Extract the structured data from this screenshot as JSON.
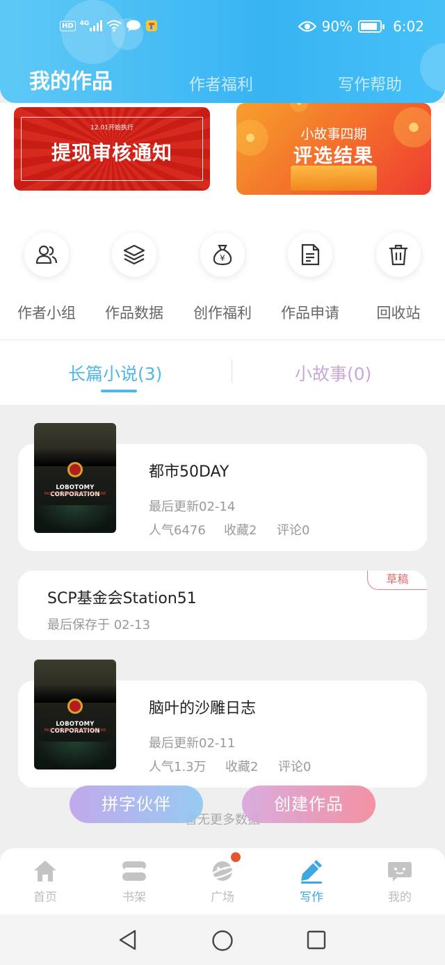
{
  "status_bar": {
    "hd": "HD",
    "network": "4G",
    "battery": "90%",
    "battery_level": 0.9,
    "time": "6:02"
  },
  "top_tabs": [
    {
      "label": "我的作品",
      "active": true
    },
    {
      "label": "作者福利",
      "active": false
    },
    {
      "label": "写作帮助",
      "active": false
    }
  ],
  "banners": {
    "left": {
      "small": "12.01开始执行",
      "big": "提现审核通知"
    },
    "right": {
      "line1": "小故事四期",
      "line2": "评选结果"
    }
  },
  "quick_actions": [
    {
      "label": "作者小组",
      "icon": "users-icon"
    },
    {
      "label": "作品数据",
      "icon": "layers-icon"
    },
    {
      "label": "创作福利",
      "icon": "money-bag-icon"
    },
    {
      "label": "作品申请",
      "icon": "document-icon"
    },
    {
      "label": "回收站",
      "icon": "trash-icon"
    }
  ],
  "segments": {
    "novel": "长篇小说(3)",
    "story": "小故事(0)"
  },
  "works": [
    {
      "title": "都市50DAY",
      "updated": "最后更新02-14",
      "popularity": "人气6476",
      "favorites": "收藏2",
      "comments": "评论0",
      "cover_title": "LOBOTOMY CORPORATION",
      "cover_sub": "FACE THE FEAR, MAKE THE FUTURE"
    },
    {
      "title": "SCP基金会Station51",
      "saved": "最后保存于 02-13",
      "badge": "草稿"
    },
    {
      "title": "脑叶的沙雕日志",
      "updated": "最后更新02-11",
      "popularity": "人气1.3万",
      "favorites": "收藏2",
      "comments": "评论0",
      "cover_title": "LOBOTOMY CORPORATION",
      "cover_sub": "FACE THE FEAR, MAKE THE FUTURE"
    }
  ],
  "no_more": "暂无更多数据",
  "float_buttons": {
    "left": "拼字伙伴",
    "right": "创建作品"
  },
  "bottom_nav": [
    {
      "label": "首页",
      "icon": "home-icon"
    },
    {
      "label": "书架",
      "icon": "bookshelf-icon"
    },
    {
      "label": "广场",
      "icon": "planet-icon"
    },
    {
      "label": "写作",
      "icon": "pen-icon",
      "active": true
    },
    {
      "label": "我的",
      "icon": "chat-face-icon"
    }
  ],
  "colors": {
    "accent": "#3da7e4",
    "header": "#38b4f3",
    "draft": "#e06b6b"
  }
}
